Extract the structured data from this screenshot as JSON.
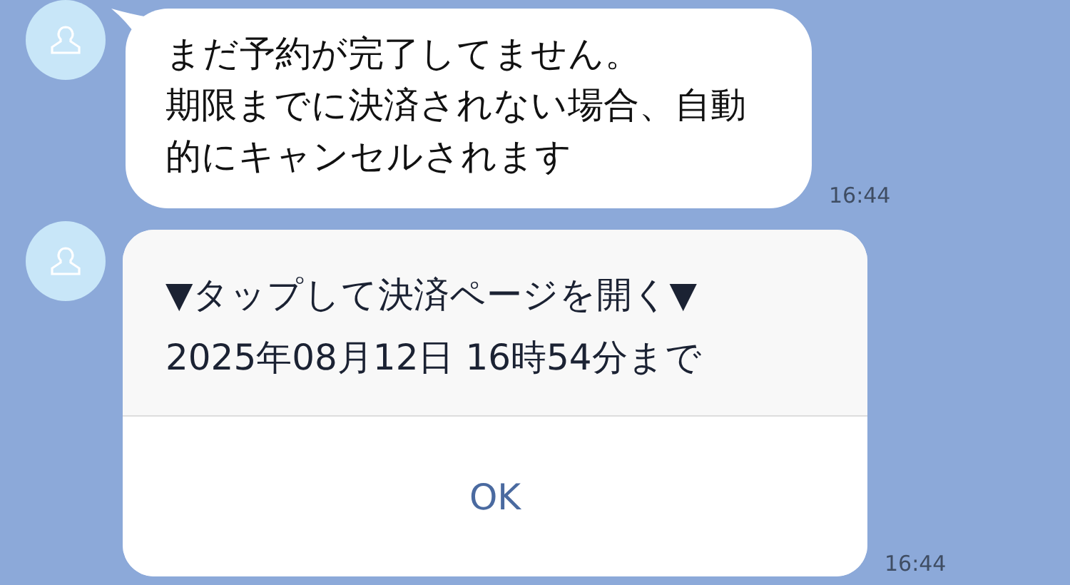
{
  "messages": [
    {
      "kind": "text",
      "lines": [
        "まだ予約が完了してません。",
        "期限までに決済されない場合、自動的にキャンセルされます"
      ],
      "time": "16:44"
    },
    {
      "kind": "card",
      "lines": [
        "▼タップして決済ページを開く▼",
        "2025年08月12日 16時54分まで"
      ],
      "button": "OK",
      "time": "16:44"
    }
  ]
}
